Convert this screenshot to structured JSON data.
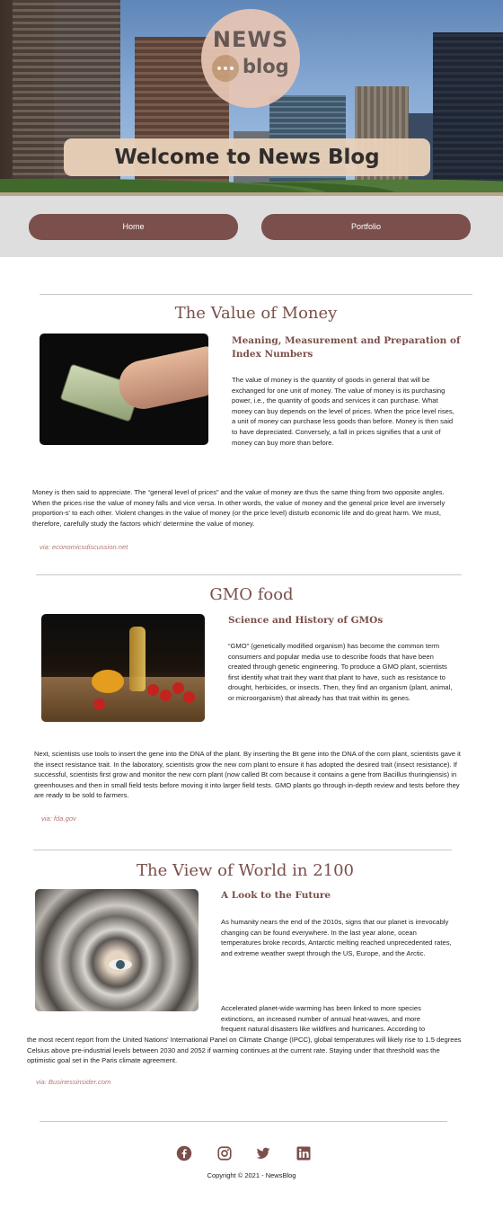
{
  "header": {
    "logo_top": "NEWS",
    "logo_bottom": "blog",
    "welcome": "Welcome to News Blog"
  },
  "nav": {
    "items": [
      {
        "label": "Home"
      },
      {
        "label": "Portfolio"
      }
    ]
  },
  "articles": [
    {
      "title": "The Value of Money",
      "subtitle": "Meaning, Measurement and Preparation of Index Numbers",
      "intro": "The value of money is the quantity of goods in general that will be exchanged for one unit of money. The value of money is its purchasing power, i.e., the quantity of goods and services it can purchase. What money can buy depends on the level of prices. When the price level rises, a unit of money can purchase less goods than before. Money is then said to have depreciated. Conversely, a fall in prices signifies that a unit of money can buy more than before.",
      "body": "Money is then said to appreciate. The “general level of prices” and the value of money are thus the same thing from two opposite angles. When the prices rise the value of money falls and vice versa. In other words, the value of money and the general price level are inversely proportion-s' to each other. Violent changes in the value of money (or the price level) disturb economic life and do great harm. We must, therefore, carefully study the factors which' determine the value of money.",
      "source": "via: economicsdiscussion.net"
    },
    {
      "title": "GMO food",
      "subtitle": "Science and History of GMOs",
      "intro": "“GMO” (genetically modified organism) has become the common term consumers and popular media use to describe foods that have been created through genetic engineering. To produce a GMO plant, scientists first identify what trait they want that plant to have, such as resistance to drought, herbicides, or insects. Then, they find an organism (plant, animal, or microorganism) that already has that trait within its genes.",
      "body": "Next, scientists use tools to insert the gene into the DNA of the plant. By inserting the Bt gene into the DNA of the corn plant, scientists gave it the insect resistance trait. In the laboratory, scientists grow the new corn plant to ensure it has adopted the desired trait (insect resistance). If successful, scientists first grow and monitor the new corn plant (now called Bt corn because it contains a gene from Bacillus thuringiensis) in greenhouses and then in small field tests before moving it into larger field tests. GMO plants go through in-depth review and tests before they are ready to be sold to farmers.",
      "source": "via: fda.gov"
    },
    {
      "title": "The View of World in 2100",
      "subtitle": "A Look to the Future",
      "intro": "As humanity nears the end of the 2010s, signs that our planet is irrevocably changing can be found everywhere. In the last year alone, ocean temperatures broke records, Antarctic melting reached unprecedented rates, and extreme weather swept through the US, Europe, and the Arctic.",
      "body_a": "Accelerated planet-wide warming has been linked to more species extinctions, an increased number of annual heat-waves, and more frequent natural disasters like wildfires and hurricanes. According to",
      "body_b": "the most recent report from the United Nations' International Panel on Climate Change (IPCC), global temperatures will likely rise to 1.5 degrees Celsius above pre-industrial levels between 2030 and 2052 if warming continues at the current rate. Staying under that threshold was the optimistic goal set in the Paris climate agreement.",
      "source": "via: Businessinsider.com"
    }
  ],
  "footer": {
    "social": [
      "facebook-icon",
      "instagram-icon",
      "twitter-icon",
      "linkedin-icon"
    ],
    "copyright": "Copyright © 2021 - NewsBlog"
  },
  "colors": {
    "accent": "#7b4f4b",
    "nav_bg": "#dedede",
    "source_text": "#b27a74"
  }
}
